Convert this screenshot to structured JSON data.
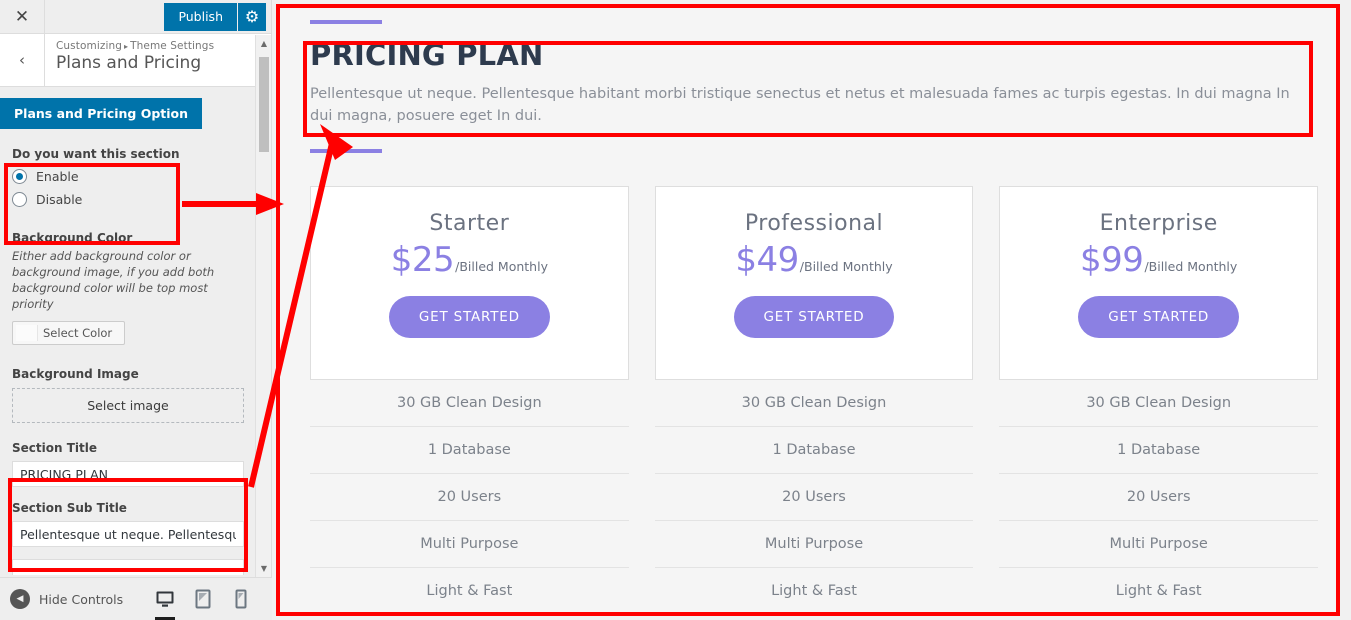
{
  "customizer": {
    "close_icon": "✕",
    "publish_label": "Publish",
    "gear_icon": "⚙",
    "back_icon": "‹",
    "breadcrumb_root": "Customizing",
    "breadcrumb_sep": "▸",
    "breadcrumb_parent": "Theme Settings",
    "section_name": "Plans and Pricing",
    "panel_button_label": "Plans and Pricing Option",
    "enable_field": {
      "label": "Do you want this section",
      "options": [
        {
          "label": "Enable",
          "checked": true
        },
        {
          "label": "Disable",
          "checked": false
        }
      ]
    },
    "background_color": {
      "label": "Background Color",
      "description": "Either add background color or background image, if you add both background color will be top most priority",
      "button_label": "Select Color"
    },
    "background_image": {
      "label": "Background Image",
      "button_label": "Select image"
    },
    "section_title": {
      "label": "Section Title",
      "value": "PRICING PLAN"
    },
    "section_sub_title": {
      "label": "Section Sub Title",
      "value": "Pellentesque ut neque. Pellentesque ha"
    },
    "footer": {
      "hide_controls_label": "Hide Controls",
      "hide_icon": "◀",
      "devices": [
        {
          "name": "desktop",
          "icon": "desktop-icon",
          "active": true
        },
        {
          "name": "tablet",
          "icon": "tablet-icon",
          "active": false
        },
        {
          "name": "mobile",
          "icon": "mobile-icon",
          "active": false
        }
      ]
    },
    "scrollbar": {
      "up_icon": "▲",
      "down_icon": "▼"
    }
  },
  "preview": {
    "title": "PRICING PLAN",
    "subtitle": "Pellentesque ut neque. Pellentesque habitant morbi tristique senectus et netus et malesuada fames ac turpis egestas. In dui magna In dui magna, posuere eget In dui.",
    "accent_color": "#8b80e3",
    "title_color": "#2e3b4e",
    "plans": [
      {
        "name": "Starter",
        "price": "$25",
        "billed": "/Billed Monthly",
        "cta": "GET STARTED",
        "features": [
          "30 GB Clean Design",
          "1 Database",
          "20 Users",
          "Multi Purpose",
          "Light & Fast"
        ]
      },
      {
        "name": "Professional",
        "price": "$49",
        "billed": "/Billed Monthly",
        "cta": "GET STARTED",
        "features": [
          "30 GB Clean Design",
          "1 Database",
          "20 Users",
          "Multi Purpose",
          "Light & Fast"
        ]
      },
      {
        "name": "Enterprise",
        "price": "$99",
        "billed": "/Billed Monthly",
        "cta": "GET STARTED",
        "features": [
          "30 GB Clean Design",
          "1 Database",
          "20 Users",
          "Multi Purpose",
          "Light & Fast"
        ]
      }
    ]
  },
  "annotations": {
    "color": "#ff0000",
    "boxes": [
      "preview-frame",
      "preview-title-block",
      "enable-disable-control",
      "section-title-and-subtitle-fields"
    ],
    "arrows": [
      "enable-control-to-preview-frame",
      "subtitle-field-to-preview-subtitle"
    ]
  }
}
